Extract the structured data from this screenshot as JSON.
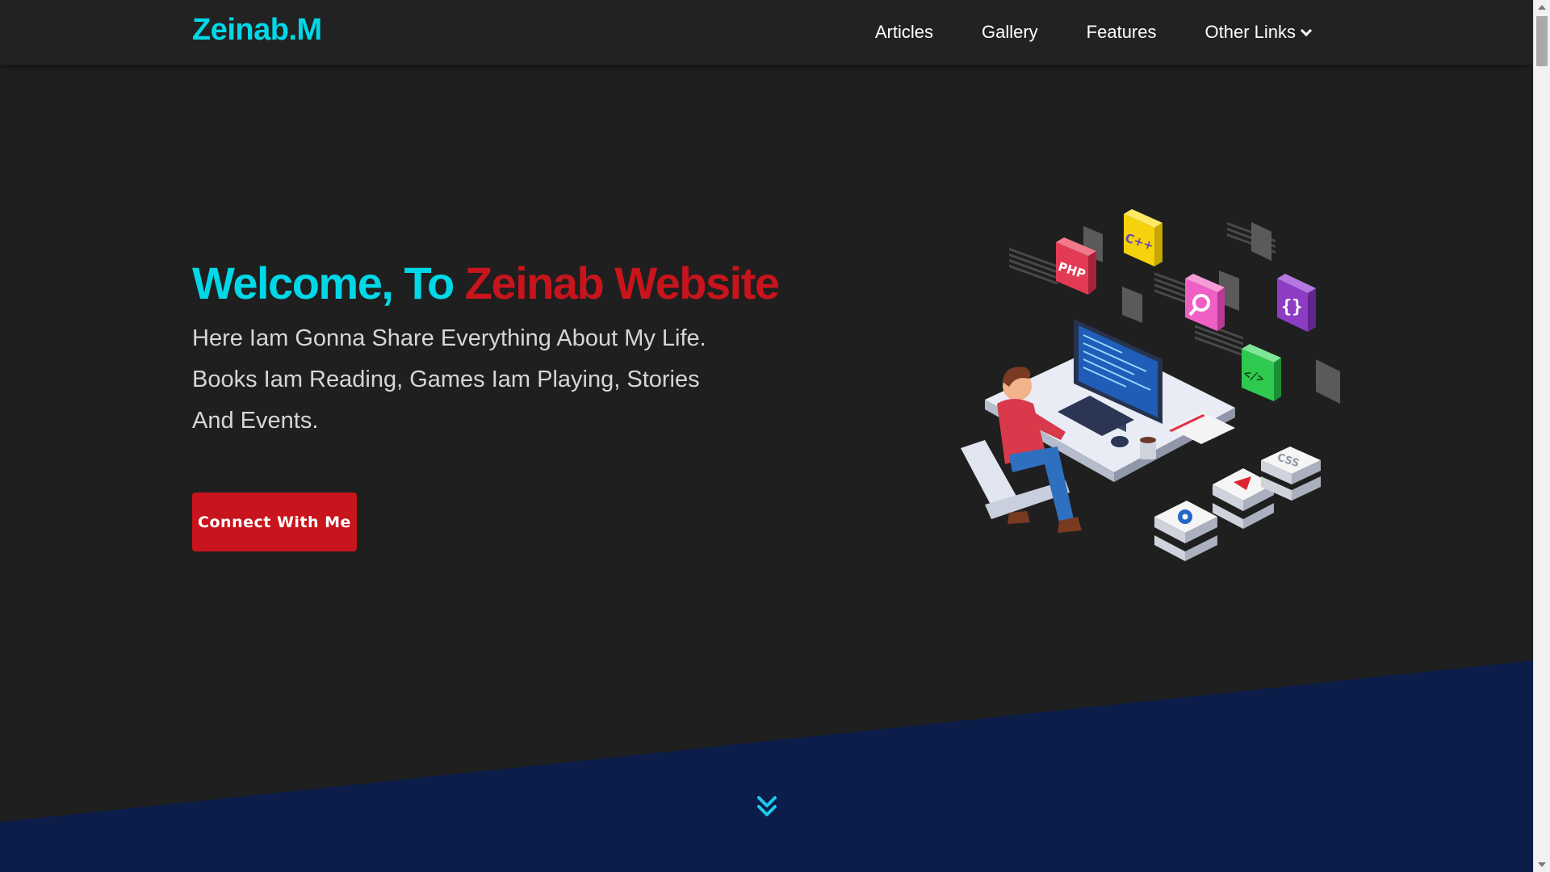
{
  "header": {
    "logo": "Zeinab.M",
    "nav": [
      {
        "label": "Articles"
      },
      {
        "label": "Gallery"
      },
      {
        "label": "Features"
      },
      {
        "label": "Other Links"
      }
    ]
  },
  "hero": {
    "title_part1": "Welcome, To",
    "title_part2": "Zeinab Website",
    "subtitle": "Here Iam Gonna Share Everything About My Life. Books Iam Reading, Games Iam Playing, Stories And Events.",
    "cta_label": "Connect With Me"
  },
  "illustration": {
    "labels": [
      "PHP",
      "C++",
      "{}",
      "</>",
      "CSS"
    ]
  },
  "colors": {
    "background": "#1f1f1f",
    "header": "#222222",
    "accent_cyan": "#00d8e8",
    "accent_red": "#c8141c",
    "wave_navy": "#0b1d48"
  },
  "icons": {
    "dropdown": "chevron-down-icon",
    "scroll": "double-chevron-down-icon"
  }
}
